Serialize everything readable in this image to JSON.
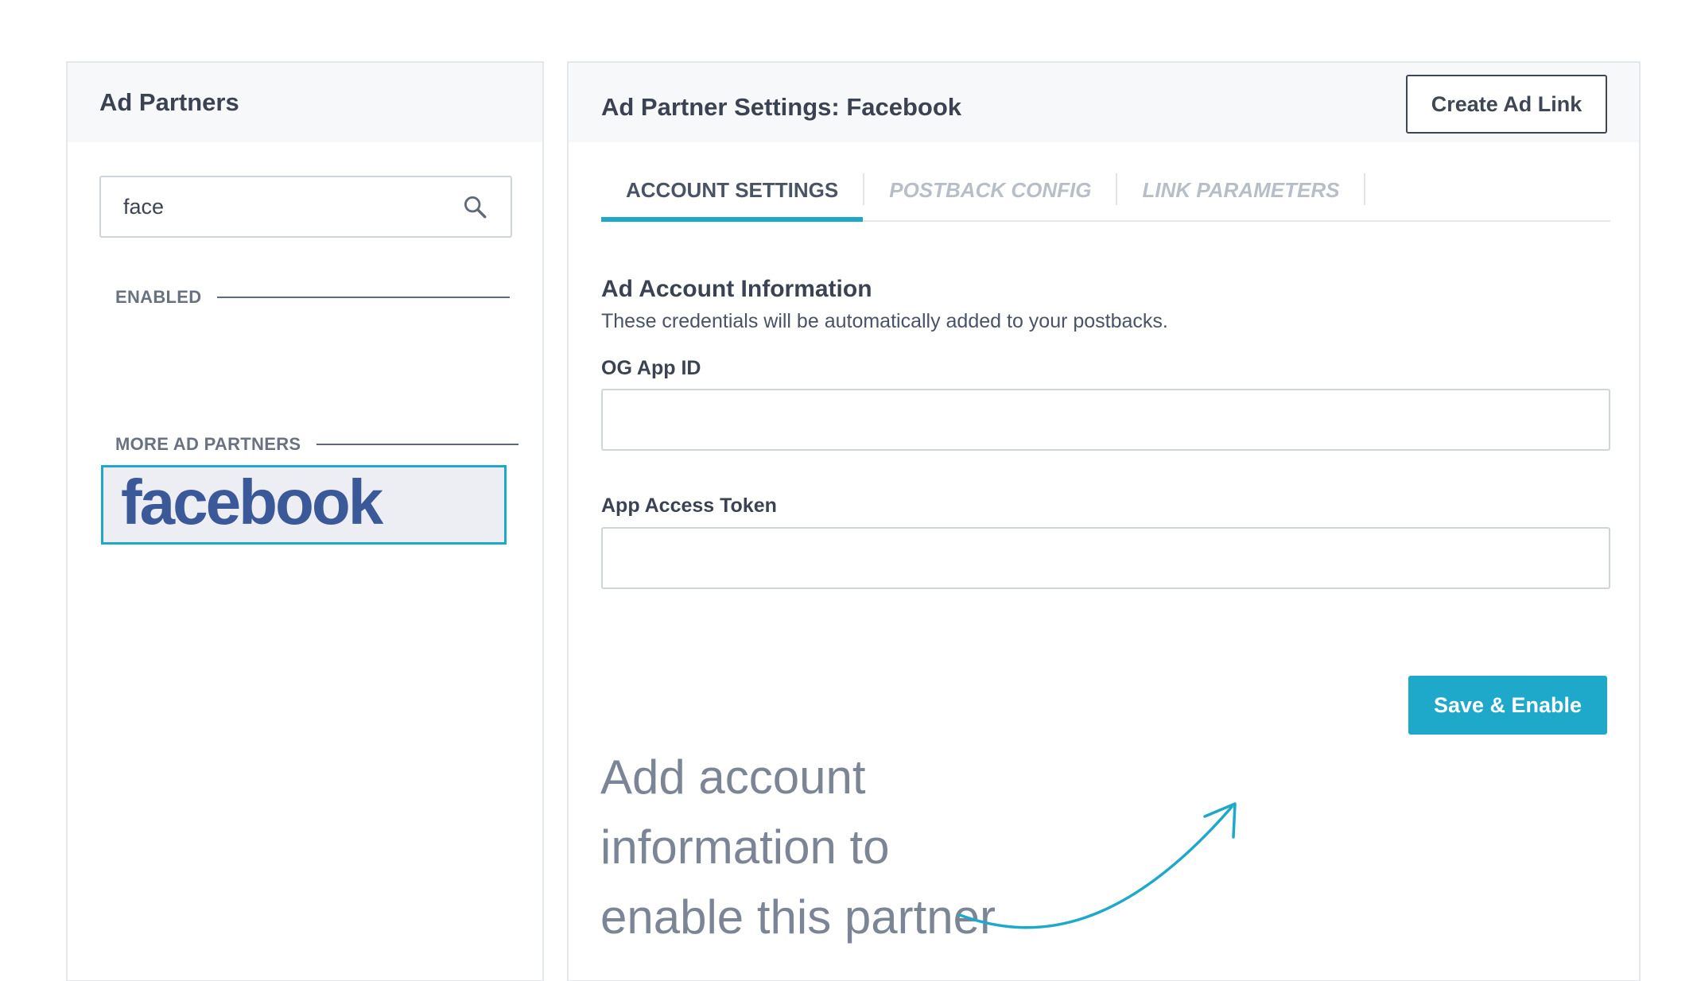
{
  "left": {
    "title": "Ad Partners",
    "search": {
      "value": "face",
      "placeholder": ""
    },
    "section_enabled": "ENABLED",
    "section_more": "MORE AD PARTNERS",
    "partners": [
      {
        "name": "facebook"
      }
    ]
  },
  "right": {
    "title": "Ad Partner Settings: Facebook",
    "create_button": "Create Ad Link",
    "tabs": [
      {
        "label": "ACCOUNT SETTINGS",
        "active": true
      },
      {
        "label": "POSTBACK CONFIG",
        "active": false
      },
      {
        "label": "LINK PARAMETERS",
        "active": false
      }
    ],
    "form": {
      "heading": "Ad Account Information",
      "description": "These credentials will be automatically added to your postbacks.",
      "fields": [
        {
          "label": "OG App ID",
          "value": ""
        },
        {
          "label": "App Access Token",
          "value": ""
        }
      ],
      "save_button": "Save & Enable"
    },
    "annotation": {
      "lines": [
        "Add account",
        "information to",
        "enable this partner"
      ]
    }
  },
  "colors": {
    "accent": "#1ea8c9",
    "facebook_brand": "#3b5998",
    "text_dark": "#3b4252",
    "text_muted": "#7b8596"
  },
  "icons": {
    "search": "search-icon",
    "arrow": "curved-arrow-icon"
  }
}
